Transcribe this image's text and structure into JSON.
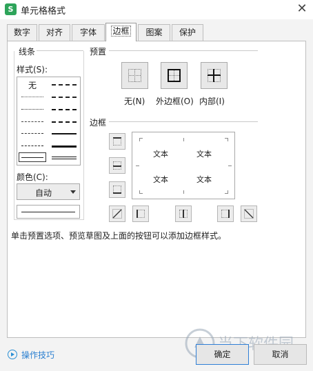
{
  "window": {
    "title": "单元格格式",
    "app_icon": "S",
    "close_glyph": "✕"
  },
  "tabs": [
    {
      "label": "数字",
      "active": false
    },
    {
      "label": "对齐",
      "active": false
    },
    {
      "label": "字体",
      "active": false
    },
    {
      "label": "边框",
      "active": true
    },
    {
      "label": "图案",
      "active": false
    },
    {
      "label": "保护",
      "active": false
    }
  ],
  "line_group": {
    "title": "线条",
    "style_label": "样式(S):",
    "none_option": "无",
    "color_label": "颜色(C):",
    "color_value": "自动"
  },
  "preset_group": {
    "title": "预置",
    "buttons": [
      {
        "label": "无(N)"
      },
      {
        "label": "外边框(O)"
      },
      {
        "label": "内部(I)"
      }
    ]
  },
  "border_group": {
    "title": "边框",
    "preview_text": [
      "文本",
      "文本",
      "文本",
      "文本"
    ]
  },
  "hint": "单击预置选项、预览草图及上面的按钮可以添加边框样式。",
  "footer": {
    "tips_link": "操作技巧",
    "ok_label": "确定",
    "cancel_label": "取消"
  },
  "watermark": {
    "text": "当下软件园"
  },
  "colors": {
    "accent": "#2a7fd0",
    "app_icon_bg": "#2ea45a",
    "ok_border": "#2f7fd6"
  }
}
